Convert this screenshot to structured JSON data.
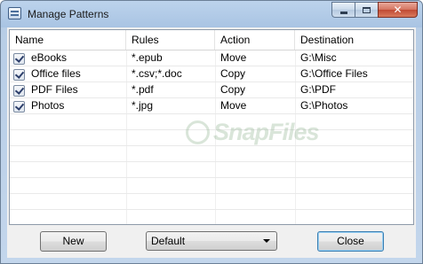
{
  "window": {
    "title": "Manage Patterns"
  },
  "columns": [
    "Name",
    "Rules",
    "Action",
    "Destination"
  ],
  "rows": [
    {
      "checked": true,
      "name": "eBooks",
      "rules": "*.epub",
      "action": "Move",
      "destination": "G:\\Misc"
    },
    {
      "checked": true,
      "name": "Office files",
      "rules": "*.csv;*.doc",
      "action": "Copy",
      "destination": "G:\\Office Files"
    },
    {
      "checked": true,
      "name": "PDF Files",
      "rules": "*.pdf",
      "action": "Copy",
      "destination": "G:\\PDF"
    },
    {
      "checked": true,
      "name": "Photos",
      "rules": "*.jpg",
      "action": "Move",
      "destination": "G:\\Photos"
    }
  ],
  "watermark": "SnapFiles",
  "buttons": {
    "new_label": "New",
    "close_label": "Close"
  },
  "preset": {
    "selected": "Default"
  },
  "colors": {
    "title_bar": "#bcd3ec",
    "close_caption": "#c04a33",
    "list_background": "#ffffff"
  }
}
